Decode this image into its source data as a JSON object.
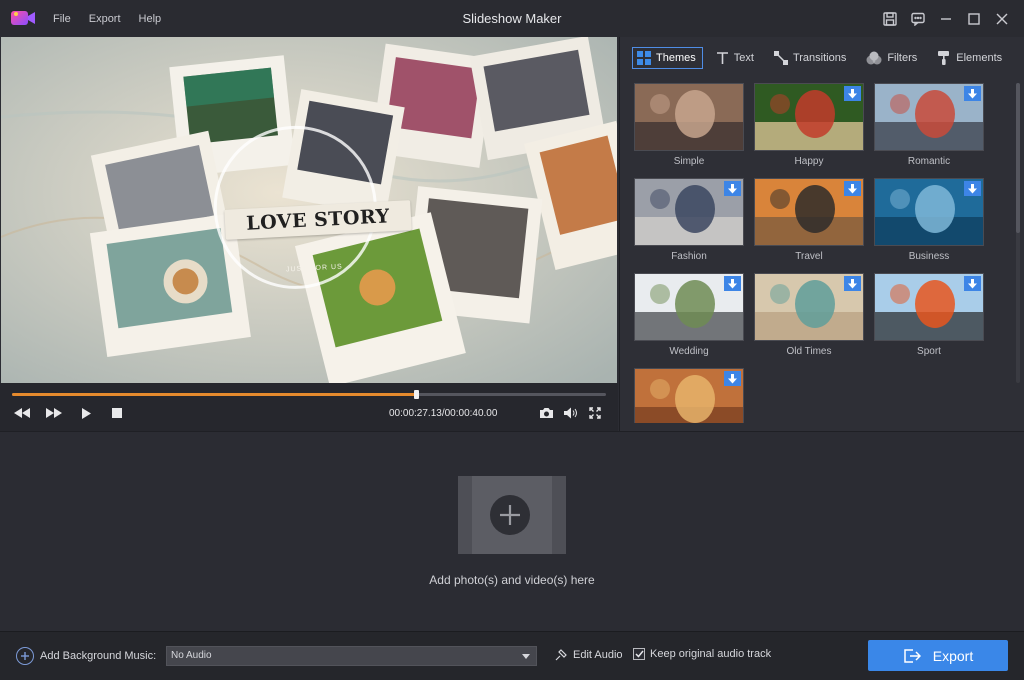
{
  "titlebar": {
    "title": "Slideshow Maker",
    "menu": [
      "File",
      "Export",
      "Help"
    ]
  },
  "preview": {
    "title_text": "LOVE STORY",
    "subtitle_text": "JUST FOR US",
    "timecode": "00:00:27.13/00:00:40.00",
    "progress": 0.68
  },
  "panel": {
    "tabs": [
      {
        "label": "Themes",
        "icon": "themes-grid-icon"
      },
      {
        "label": "Text",
        "icon": "text-t-icon"
      },
      {
        "label": "Transitions",
        "icon": "transitions-icon"
      },
      {
        "label": "Filters",
        "icon": "filters-circles-icon"
      },
      {
        "label": "Elements",
        "icon": "elements-roller-icon"
      }
    ],
    "themes": [
      {
        "label": "Simple",
        "download": false,
        "colors": [
          "#8a6a56",
          "#c7a48d",
          "#3a3030"
        ]
      },
      {
        "label": "Happy",
        "download": true,
        "colors": [
          "#2f5a22",
          "#c23b2a",
          "#e2c79a"
        ]
      },
      {
        "label": "Romantic",
        "download": true,
        "colors": [
          "#9ab3c9",
          "#c94a3a",
          "#3a3f4a"
        ]
      },
      {
        "label": "Fashion",
        "download": true,
        "colors": [
          "#9b9fa8",
          "#3b4660",
          "#d3d0cc"
        ]
      },
      {
        "label": "Travel",
        "download": true,
        "colors": [
          "#d9843a",
          "#2e2b2a",
          "#7a5b3f"
        ]
      },
      {
        "label": "Business",
        "download": true,
        "colors": [
          "#1f6b9a",
          "#7fb7d8",
          "#0f3d5e"
        ]
      },
      {
        "label": "Wedding",
        "download": true,
        "colors": [
          "#e9ecef",
          "#6f8c54",
          "#4a4d52"
        ]
      },
      {
        "label": "Old Times",
        "download": true,
        "colors": [
          "#d7c8ad",
          "#5f9e9a",
          "#b9a283"
        ]
      },
      {
        "label": "Sport",
        "download": true,
        "colors": [
          "#a9cde9",
          "#e8561f",
          "#2f3134"
        ]
      },
      {
        "label": "",
        "download": true,
        "colors": [
          "#c0713b",
          "#e6b36b",
          "#7a3f22"
        ]
      }
    ]
  },
  "media": {
    "add_label": "Add photo(s) and video(s) here"
  },
  "bottom": {
    "bgm_label": "Add Background Music:",
    "audio_value": "No Audio",
    "edit_audio": "Edit Audio",
    "keep_audio": "Keep original audio track",
    "keep_checked": true,
    "export_label": "Export"
  },
  "colors": {
    "accent": "#3a87e8",
    "progress": "#e58a2d",
    "bg": "#2b2c33"
  }
}
